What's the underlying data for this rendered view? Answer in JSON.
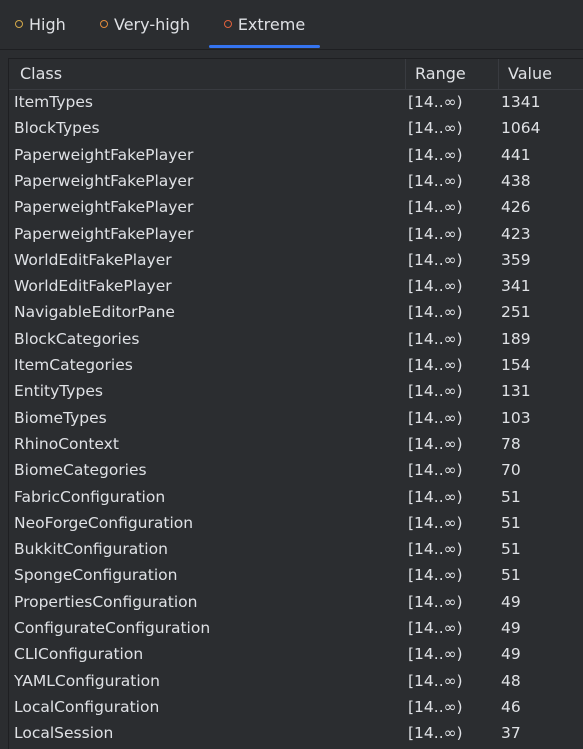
{
  "tabs": [
    {
      "label": "High",
      "color": "#d4a94a",
      "selected": false
    },
    {
      "label": "Very-high",
      "color": "#e08a3c",
      "selected": false
    },
    {
      "label": "Extreme",
      "color": "#e0613c",
      "selected": true
    }
  ],
  "table": {
    "columns": [
      "Class",
      "Range",
      "Value"
    ],
    "rows": [
      {
        "class": "ItemTypes",
        "range": "[14..∞)",
        "value": "1341"
      },
      {
        "class": "BlockTypes",
        "range": "[14..∞)",
        "value": "1064"
      },
      {
        "class": "PaperweightFakePlayer",
        "range": "[14..∞)",
        "value": "441"
      },
      {
        "class": "PaperweightFakePlayer",
        "range": "[14..∞)",
        "value": "438"
      },
      {
        "class": "PaperweightFakePlayer",
        "range": "[14..∞)",
        "value": "426"
      },
      {
        "class": "PaperweightFakePlayer",
        "range": "[14..∞)",
        "value": "423"
      },
      {
        "class": "WorldEditFakePlayer",
        "range": "[14..∞)",
        "value": "359"
      },
      {
        "class": "WorldEditFakePlayer",
        "range": "[14..∞)",
        "value": "341"
      },
      {
        "class": "NavigableEditorPane",
        "range": "[14..∞)",
        "value": "251"
      },
      {
        "class": "BlockCategories",
        "range": "[14..∞)",
        "value": "189"
      },
      {
        "class": "ItemCategories",
        "range": "[14..∞)",
        "value": "154"
      },
      {
        "class": "EntityTypes",
        "range": "[14..∞)",
        "value": "131"
      },
      {
        "class": "BiomeTypes",
        "range": "[14..∞)",
        "value": "103"
      },
      {
        "class": "RhinoContext",
        "range": "[14..∞)",
        "value": "78"
      },
      {
        "class": "BiomeCategories",
        "range": "[14..∞)",
        "value": "70"
      },
      {
        "class": "FabricConfiguration",
        "range": "[14..∞)",
        "value": "51"
      },
      {
        "class": "NeoForgeConfiguration",
        "range": "[14..∞)",
        "value": "51"
      },
      {
        "class": "BukkitConfiguration",
        "range": "[14..∞)",
        "value": "51"
      },
      {
        "class": "SpongeConfiguration",
        "range": "[14..∞)",
        "value": "51"
      },
      {
        "class": "PropertiesConfiguration",
        "range": "[14..∞)",
        "value": "49"
      },
      {
        "class": "ConfigurateConfiguration",
        "range": "[14..∞)",
        "value": "49"
      },
      {
        "class": "CLIConfiguration",
        "range": "[14..∞)",
        "value": "49"
      },
      {
        "class": "YAMLConfiguration",
        "range": "[14..∞)",
        "value": "48"
      },
      {
        "class": "LocalConfiguration",
        "range": "[14..∞)",
        "value": "46"
      },
      {
        "class": "LocalSession",
        "range": "[14..∞)",
        "value": "37"
      }
    ]
  }
}
